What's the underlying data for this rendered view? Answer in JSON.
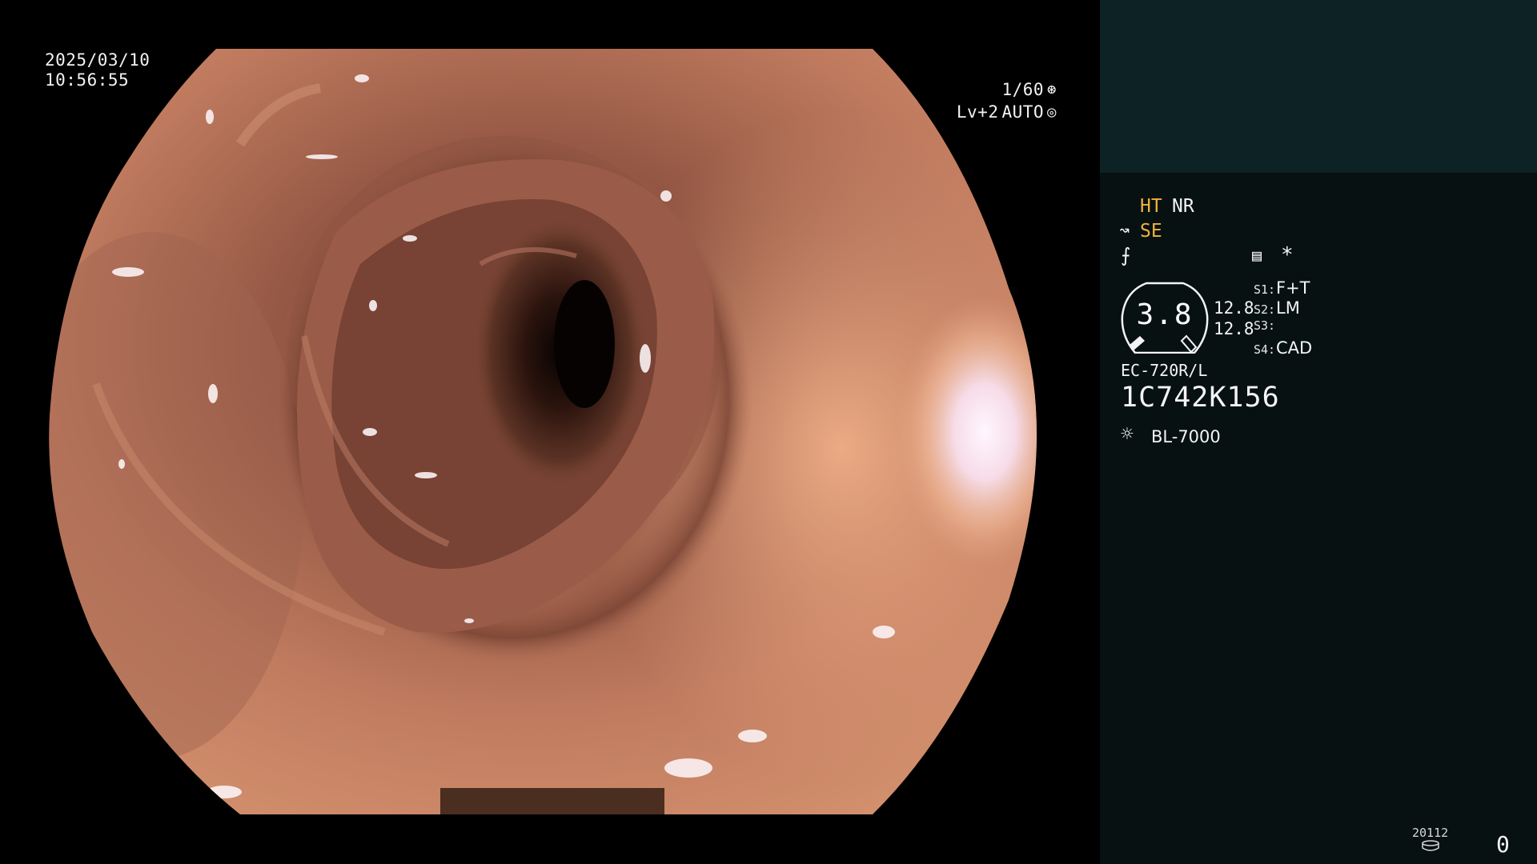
{
  "scope_view": {
    "date": "2025/03/10",
    "time": "10:56:55",
    "shutter": "1/60",
    "shutter_icon": "aperture-icon",
    "level": "Lv+2",
    "mode": "AUTO",
    "mode_icon": "iris-icon"
  },
  "info_panel": {
    "mode_ht": "HT",
    "mode_nr": "NR",
    "mode_se": "SE",
    "asterisk": "*",
    "gauge": {
      "value": "3.8",
      "reading_1": "12.8",
      "reading_2": "12.8"
    },
    "switches": [
      {
        "key": "S1:",
        "value": "F+T"
      },
      {
        "key": "S2:",
        "value": "LM"
      },
      {
        "key": "S3:",
        "value": ""
      },
      {
        "key": "S4:",
        "value": "CAD"
      }
    ],
    "scope_model": "EC-720R/L",
    "serial": "1C742K156",
    "light_source": "BL-7000",
    "storage_counter": "20112",
    "count": "0"
  },
  "colors": {
    "panel_background": "#071112",
    "panel_header": "#0c2225",
    "amber_indicator": "#f3b13c",
    "overlay_text": "#f2f2f2"
  }
}
